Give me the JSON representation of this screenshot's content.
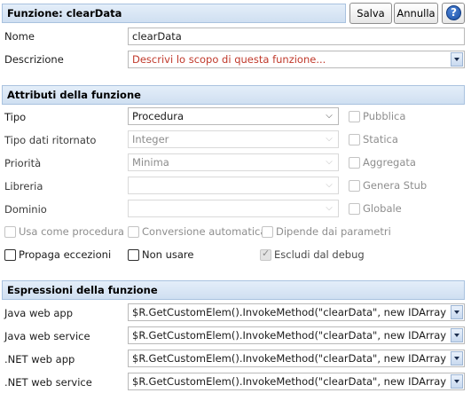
{
  "header": {
    "title": "Funzione: clearData",
    "save_label": "Salva",
    "cancel_label": "Annulla",
    "help_glyph": "?"
  },
  "general": {
    "name_label": "Nome",
    "name_value": "clearData",
    "description_label": "Descrizione",
    "description_placeholder": "Descrivi lo scopo di questa funzione..."
  },
  "attributes": {
    "section_title": "Attributi della funzione",
    "tipo_label": "Tipo",
    "tipo_value": "Procedura",
    "return_type_label": "Tipo dati ritornato",
    "return_type_value": "Integer",
    "priority_label": "Priorità",
    "priority_value": "Minima",
    "library_label": "Libreria",
    "library_value": "",
    "domain_label": "Dominio",
    "domain_value": "",
    "right_checks": {
      "pubblica": "Pubblica",
      "statica": "Statica",
      "aggregata": "Aggregata",
      "genera_stub": "Genera Stub",
      "globale": "Globale"
    },
    "row_checks": {
      "usa_come_procedura": "Usa come procedura",
      "conversione_automatica": "Conversione automatica",
      "dipende_dai_parametri": "Dipende dai parametri",
      "propaga_eccezioni": "Propaga eccezioni",
      "non_usare": "Non usare",
      "escludi_dal_debug": "Escludi dal debug"
    }
  },
  "expressions": {
    "section_title": "Espressioni della funzione",
    "rows": [
      {
        "label": "Java web app",
        "value": "$R.GetCustomElem().InvokeMethod(\"clearData\", new IDArray"
      },
      {
        "label": "Java web service",
        "value": "$R.GetCustomElem().InvokeMethod(\"clearData\", new IDArray"
      },
      {
        "label": ".NET web app",
        "value": "$R.GetCustomElem().InvokeMethod(\"clearData\", new IDArray"
      },
      {
        "label": ".NET web service",
        "value": "$R.GetCustomElem().InvokeMethod(\"clearData\", new IDArray"
      }
    ]
  },
  "colors": {
    "header_bar": "#cfdff1",
    "placeholder_red": "#c0392b",
    "help_blue": "#1b4fa3"
  }
}
